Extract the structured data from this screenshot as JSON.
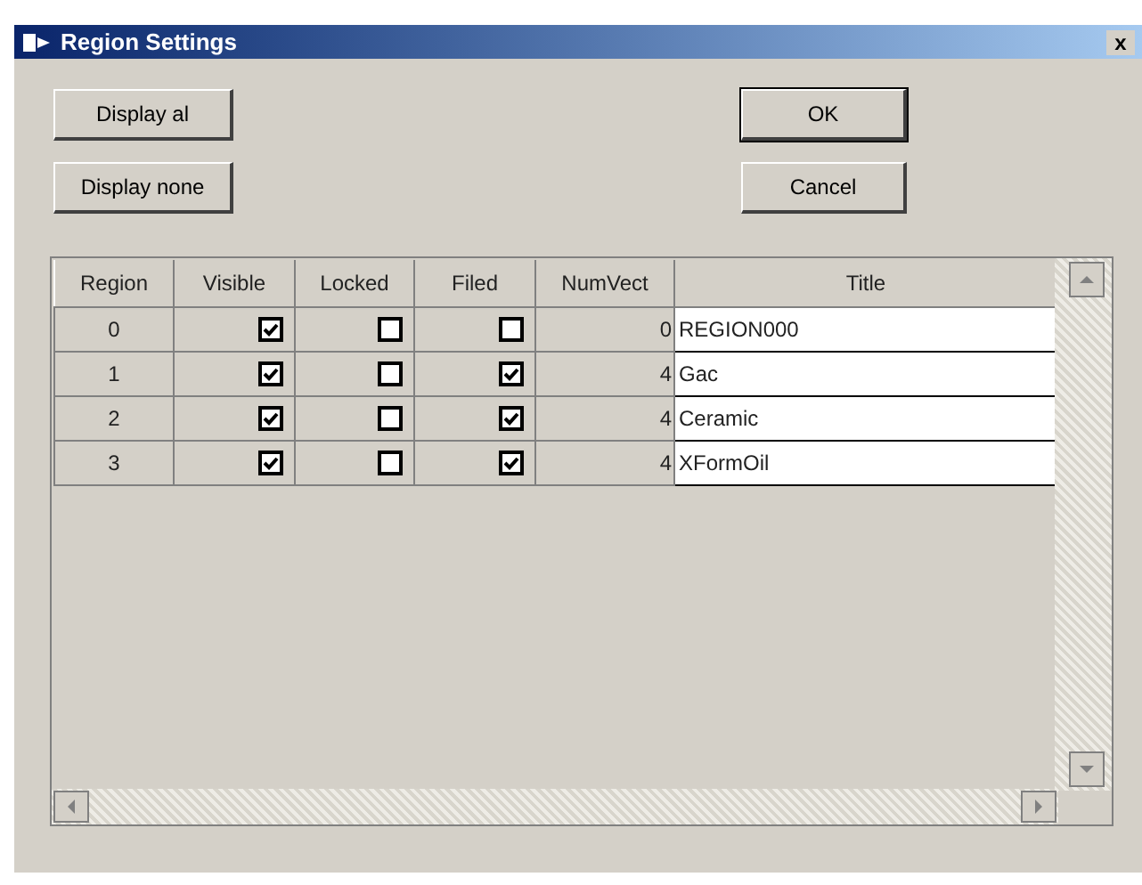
{
  "window": {
    "title": "Region Settings",
    "close": "x"
  },
  "buttons": [
    {
      "label": "Display al",
      "default": false
    },
    {
      "label": "OK",
      "default": true
    },
    {
      "label": "Display none",
      "default": false
    },
    {
      "label": "Cancel",
      "default": false
    }
  ],
  "table": {
    "columns": [
      "Region",
      "Visible",
      "Locked",
      "Filed",
      "NumVect",
      "Title"
    ],
    "rows": [
      {
        "region": "0",
        "visible": true,
        "locked": false,
        "filled": false,
        "numvect": "0",
        "title": "REGION000"
      },
      {
        "region": "1",
        "visible": true,
        "locked": false,
        "filled": true,
        "numvect": "4",
        "title": "Gac"
      },
      {
        "region": "2",
        "visible": true,
        "locked": false,
        "filled": true,
        "numvect": "4",
        "title": "Ceramic"
      },
      {
        "region": "3",
        "visible": true,
        "locked": false,
        "filled": true,
        "numvect": "4",
        "title": "XFormOil"
      }
    ]
  }
}
